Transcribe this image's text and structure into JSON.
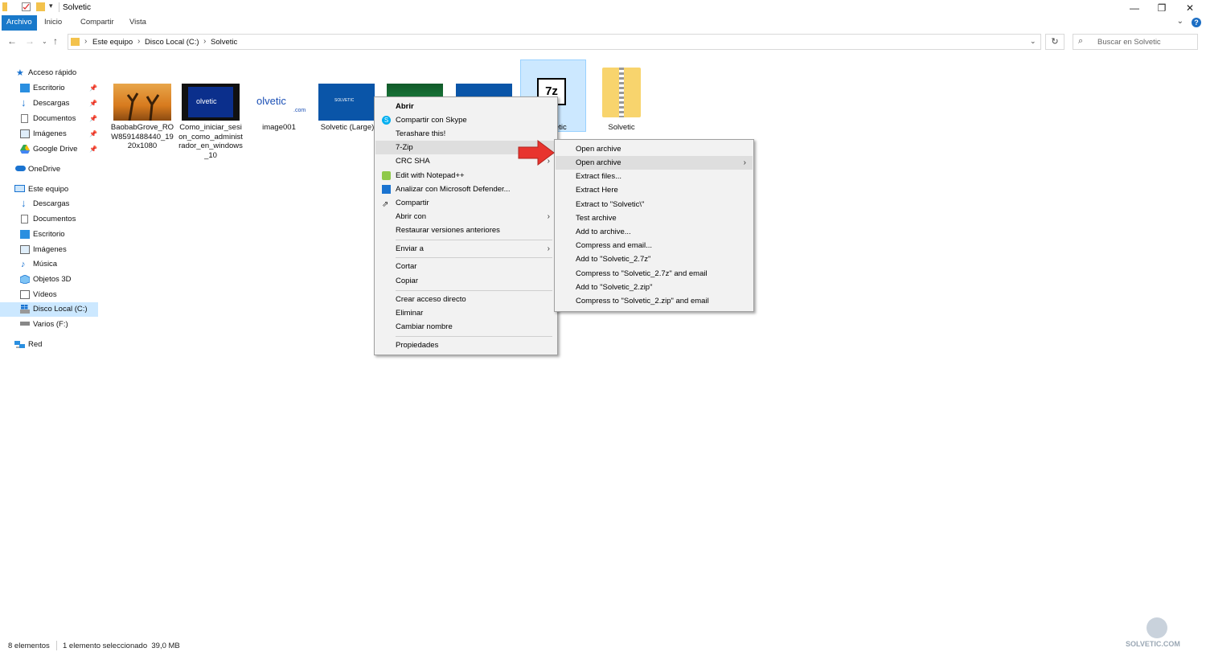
{
  "window": {
    "title": "Solvetic",
    "minimize_glyph": "—",
    "restore_glyph": "❐",
    "close_glyph": "✕"
  },
  "ribbon": {
    "tabs": [
      "Archivo",
      "Inicio",
      "Compartir",
      "Vista"
    ],
    "help_glyph": "?",
    "collapse_glyph": "⌄"
  },
  "address": {
    "crumbs": [
      "Este equipo",
      "Disco Local (C:)",
      "Solvetic"
    ],
    "search_placeholder": "Buscar en Solvetic"
  },
  "nav": {
    "quick_access": "Acceso rápido",
    "quick_items": [
      "Escritorio",
      "Descargas",
      "Documentos",
      "Imágenes",
      "Google Drive"
    ],
    "onedrive": "OneDrive",
    "this_pc": "Este equipo",
    "pc_items": [
      "Descargas",
      "Documentos",
      "Escritorio",
      "Imágenes",
      "Música",
      "Objetos 3D",
      "Vídeos",
      "Disco Local (C:)",
      "Varios (F:)"
    ],
    "network": "Red"
  },
  "files": [
    {
      "name": "BaobabGrove_ROW8591488440_1920x1080"
    },
    {
      "name": "Como_iniciar_sesion_como_administrador_en_windows_10"
    },
    {
      "name": "image001"
    },
    {
      "name": "Solvetic (Large)"
    },
    {
      "name": ""
    },
    {
      "name": ""
    },
    {
      "name": "etic"
    },
    {
      "name": "Solvetic"
    }
  ],
  "thumb_text": {
    "solvetic_logo": "olvetic",
    "solvetic_com": ".com",
    "solvetic_small": "SOLVETIC",
    "sevenzip": "7z"
  },
  "context_menu": {
    "items": [
      "Abrir",
      "Compartir con Skype",
      "Terashare this!",
      "7-Zip",
      "CRC SHA",
      "Edit with Notepad++",
      "Analizar con Microsoft Defender...",
      "Compartir",
      "Abrir con",
      "Restaurar versiones anteriores",
      "Enviar a",
      "Cortar",
      "Copiar",
      "Crear acceso directo",
      "Eliminar",
      "Cambiar nombre",
      "Propiedades"
    ]
  },
  "submenu": {
    "items": [
      "Open archive",
      "Open archive",
      "Extract files...",
      "Extract Here",
      "Extract to \"Solvetic\\\"",
      "Test archive",
      "Add to archive...",
      "Compress and email...",
      "Add to \"Solvetic_2.7z\"",
      "Compress to \"Solvetic_2.7z\" and email",
      "Add to \"Solvetic_2.zip\"",
      "Compress to \"Solvetic_2.zip\" and email"
    ]
  },
  "status": {
    "count": "8 elementos",
    "selection": "1 elemento seleccionado  39,0 MB"
  },
  "watermark": "SOLVETIC.COM",
  "colors": {
    "accent": "#1979ca",
    "selection": "#cce8ff",
    "arrow": "#e8342e"
  }
}
